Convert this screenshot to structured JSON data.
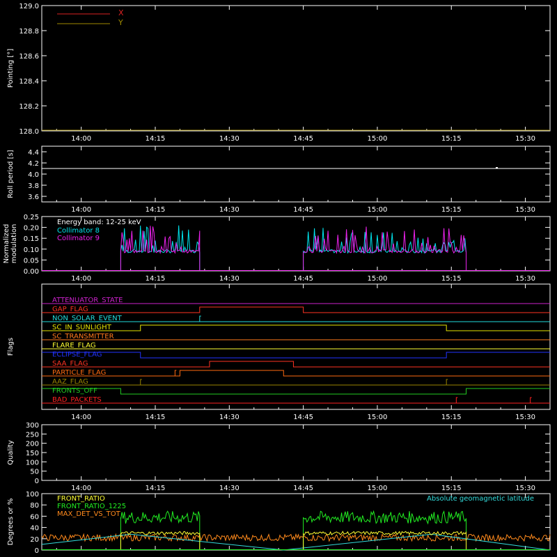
{
  "colors": {
    "background": "#000000",
    "axis": "#ffffff",
    "x_series": "#dd2222",
    "y_series": "#a08a00",
    "collimator8": "#00e5ee",
    "collimator9": "#ee22ee",
    "front_ratio": "#ffff33",
    "front_ratio_1225": "#22ee22",
    "max_det": "#ff8a1c",
    "latitude": "#33dddd"
  },
  "time_ticks": [
    "14:00",
    "14:15",
    "14:30",
    "14:45",
    "15:00",
    "15:15",
    "15:30"
  ],
  "chart_data": [
    {
      "type": "line",
      "ylabel": "Pointing [°]",
      "ylim": [
        128.0,
        129.0
      ],
      "yticks": [
        "128.0",
        "128.2",
        "128.4",
        "128.6",
        "128.8",
        "129.0"
      ],
      "legend_position": "top-left",
      "series": [
        {
          "name": "X",
          "values": [
            128.0,
            128.0
          ]
        },
        {
          "name": "Y",
          "values": [
            128.0,
            128.0
          ]
        }
      ]
    },
    {
      "type": "line",
      "ylabel": "Roll period [s]",
      "ylim": [
        3.5,
        4.5
      ],
      "yticks": [
        "3.6",
        "3.8",
        "4.0",
        "4.2",
        "4.4"
      ],
      "series": [
        {
          "values": [
            4.1,
            4.1
          ]
        }
      ]
    },
    {
      "type": "line",
      "ylabel": "Normalized modulation",
      "ylim": [
        0.0,
        0.25
      ],
      "yticks": [
        "0.00",
        "0.05",
        "0.10",
        "0.15",
        "0.20",
        "0.25"
      ],
      "annotation": "Energy band: 12-25 keV",
      "series": [
        {
          "name": "Collimator 8",
          "segments": [
            [
              "14:08",
              "14:24"
            ],
            [
              "14:45",
              "15:18"
            ]
          ],
          "baseline": 0.09
        },
        {
          "name": "Collimator 9",
          "segments": [
            [
              "14:08",
              "14:24"
            ],
            [
              "14:45",
              "15:18"
            ]
          ],
          "baseline": 0.09
        }
      ]
    },
    {
      "type": "line",
      "ylabel": "Flags",
      "flags": [
        {
          "name": "ATTENUATOR_STATE",
          "color": "#cc22cc",
          "changes": []
        },
        {
          "name": "GAP_FLAG",
          "color": "#ff3322",
          "changes": [
            [
              "14:24",
              1
            ],
            [
              "14:45",
              0
            ]
          ]
        },
        {
          "name": "NON_SOLAR_EVENT",
          "color": "#22dddd",
          "changes": [
            [
              "14:24",
              1
            ],
            [
              "14:24",
              0
            ]
          ]
        },
        {
          "name": "SC_IN_SUNLIGHT",
          "color": "#e6e600",
          "changes": [
            [
              "14:12",
              1
            ],
            [
              "15:14",
              0
            ]
          ]
        },
        {
          "name": "SC_TRANSMITTER",
          "color": "#ff7a1c",
          "changes": []
        },
        {
          "name": "FLARE_FLAG",
          "color": "#ffff33",
          "changes": []
        },
        {
          "name": "ECLIPSE_FLAG",
          "color": "#2233ff",
          "changes": [
            [
              "14:12",
              0
            ],
            [
              "15:14",
              1
            ]
          ]
        },
        {
          "name": "SAA_FLAG",
          "color": "#ff3322",
          "changes": [
            [
              "14:26",
              1
            ],
            [
              "14:43",
              0
            ]
          ]
        },
        {
          "name": "PARTICLE_FLAG",
          "color": "#ff6a10",
          "changes": [
            [
              "14:19",
              1
            ],
            [
              "14:19",
              0
            ],
            [
              "14:20",
              1
            ],
            [
              "14:41",
              0
            ]
          ]
        },
        {
          "name": "AAZ_FLAG",
          "color": "#9a8400",
          "changes": [
            [
              "14:12",
              1
            ],
            [
              "14:12",
              0
            ],
            [
              "15:14",
              1
            ],
            [
              "15:14",
              0
            ]
          ]
        },
        {
          "name": "FRONTS_OFF",
          "color": "#22cc22",
          "changes": [
            [
              "14:08",
              0
            ],
            [
              "15:18",
              1
            ]
          ]
        },
        {
          "name": "BAD_PACKETS",
          "color": "#ff2222",
          "changes": [
            [
              "15:16",
              1
            ],
            [
              "15:16",
              0
            ],
            [
              "15:31",
              1
            ],
            [
              "15:31",
              0
            ]
          ]
        }
      ]
    },
    {
      "type": "line",
      "ylabel": "Quality",
      "ylim": [
        0,
        300
      ],
      "yticks": [
        "0",
        "50",
        "100",
        "150",
        "200",
        "250",
        "300"
      ],
      "series": [
        {
          "values": [
            0,
            0
          ]
        }
      ]
    },
    {
      "type": "line",
      "ylabel": "Degrees or %",
      "ylim": [
        0,
        100
      ],
      "yticks": [
        "0",
        "20",
        "40",
        "60",
        "80",
        "100"
      ],
      "series": [
        {
          "name": "FRONT_RATIO",
          "segments": [
            [
              "14:08",
              "14:24"
            ],
            [
              "14:45",
              "15:18"
            ]
          ],
          "level": 30
        },
        {
          "name": "FRONT_RATIO_1225",
          "segments": [
            [
              "14:08",
              "14:24"
            ],
            [
              "14:45",
              "15:18"
            ]
          ],
          "level": 58
        },
        {
          "name": "MAX_DET_VS_TOT",
          "level": 22
        },
        {
          "name": "Absolute geomagnetic latitude",
          "x": [
            "13:52",
            "14:10",
            "14:41",
            "15:11",
            "15:35"
          ],
          "values": [
            10,
            28,
            0,
            28,
            0
          ]
        }
      ]
    }
  ]
}
